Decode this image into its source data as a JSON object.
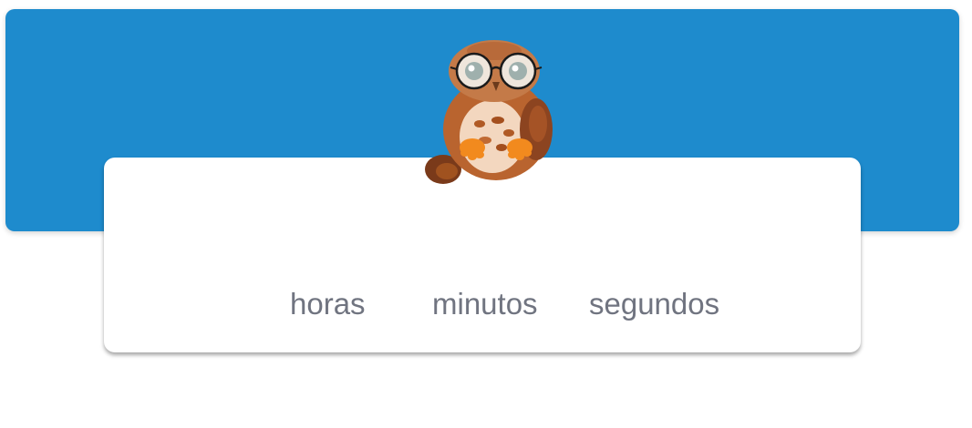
{
  "theme": {
    "banner_color": "#1e8bcd",
    "card_color": "#ffffff",
    "label_color": "#707480"
  },
  "mascot": {
    "icon": "owl-with-glasses"
  },
  "countdown": {
    "units": {
      "hours": "horas",
      "minutes": "minutos",
      "seconds": "segundos"
    }
  }
}
